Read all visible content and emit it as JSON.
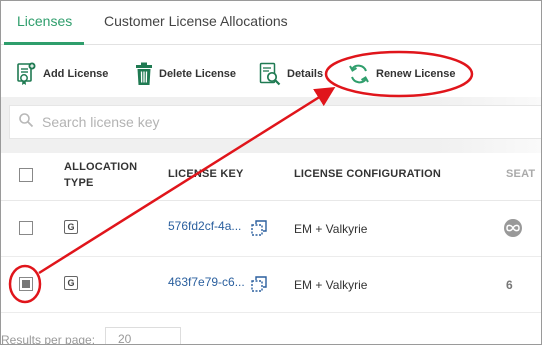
{
  "tabs": [
    {
      "label": "Licenses",
      "active": true
    },
    {
      "label": "Customer License Allocations",
      "active": false
    }
  ],
  "toolbar": {
    "add_label": "Add License",
    "delete_label": "Delete License",
    "details_label": "Details",
    "renew_label": "Renew License"
  },
  "search": {
    "placeholder": "Search license key"
  },
  "table": {
    "headers": {
      "allocation_type": "ALLOCATION TYPE",
      "license_key": "LICENSE KEY",
      "license_configuration": "LICENSE CONFIGURATION",
      "seats": "SEAT"
    },
    "rows": [
      {
        "checked": false,
        "allocation": "G",
        "license_key": "576fd2cf-4a...",
        "configuration": "EM + Valkyrie",
        "seats": "infinity-icon"
      },
      {
        "checked": true,
        "allocation": "G",
        "license_key": "463f7e79-c6...",
        "configuration": "EM + Valkyrie",
        "seats": "6"
      }
    ]
  },
  "footer": {
    "results_per_page_label": "Results per page:",
    "per_page_value": "20"
  },
  "colors": {
    "accent": "#2f9e6c",
    "annotation": "#e0151b",
    "link": "#2a5f9e"
  }
}
